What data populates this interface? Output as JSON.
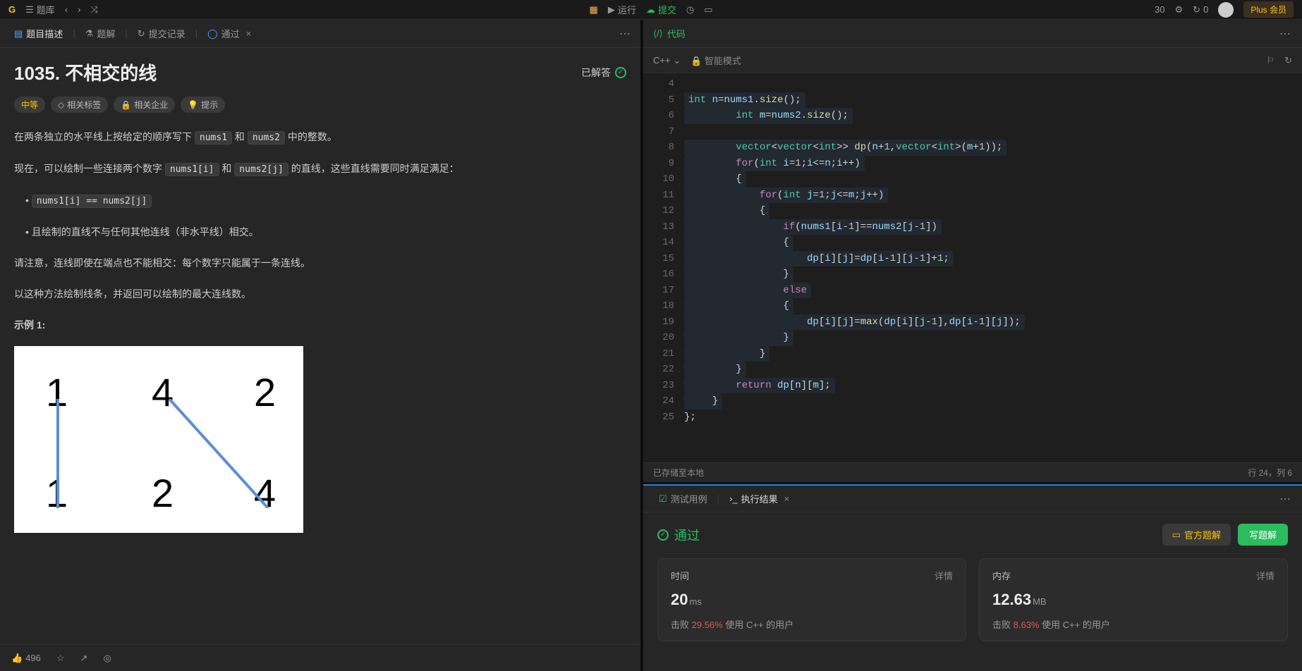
{
  "topbar": {
    "problems": "题库",
    "run": "运行",
    "submit": "提交",
    "timer": "0",
    "plus": "Plus 会员",
    "streak": "30"
  },
  "leftTabs": {
    "desc": "题目描述",
    "solution": "题解",
    "submissions": "提交记录",
    "accepted": "通过"
  },
  "problem": {
    "title": "1035. 不相交的线",
    "solvedLabel": "已解答",
    "difficulty": "中等",
    "tags": "相关标签",
    "companies": "相关企业",
    "hint": "提示",
    "p1a": "在两条独立的水平线上按给定的顺序写下 ",
    "code_nums1": "nums1",
    "p1b": " 和 ",
    "code_nums2": "nums2",
    "p1c": " 中的整数。",
    "p2a": "现在，可以绘制一些连接两个数字 ",
    "code_n1i": "nums1[i]",
    "p2b": " 和 ",
    "code_n2j": "nums2[j]",
    "p2c": " 的直线，这些直线需要同时满足满足：",
    "bullet1": "nums1[i] == nums2[j]",
    "bullet2": "且绘制的直线不与任何其他连线（非水平线）相交。",
    "p3": "请注意，连线即使在端点也不能相交：每个数字只能属于一条连线。",
    "p4": "以这种方法绘制线条，并返回可以绘制的最大连线数。",
    "ex1label": "示例 1:"
  },
  "footer": {
    "likes": "496"
  },
  "code": {
    "headerTitle": "代码",
    "lang": "C++",
    "smartMode": "智能模式",
    "savedLocal": "已存储至本地",
    "cursorPos": "行 24，列 6",
    "lineStart": 4,
    "lines": [
      "",
      "<span class='ty'>int</span> <span class='id'>n</span><span class='op'>=</span><span class='id'>nums1</span><span class='op'>.</span><span class='fn'>size</span><span class='op'>();</span>",
      "        <span class='ty'>int</span> <span class='id'>m</span><span class='op'>=</span><span class='id'>nums2</span><span class='op'>.</span><span class='fn'>size</span><span class='op'>();</span>",
      "",
      "        <span class='ty'>vector</span><span class='op'>&lt;</span><span class='ty'>vector</span><span class='op'>&lt;</span><span class='ty'>int</span><span class='op'>&gt;&gt;</span> <span class='fn'>dp</span><span class='op'>(</span><span class='id'>n</span><span class='op'>+</span><span class='nm'>1</span><span class='op'>,</span><span class='ty'>vector</span><span class='op'>&lt;</span><span class='ty'>int</span><span class='op'>&gt;(</span><span class='id'>m</span><span class='op'>+</span><span class='nm'>1</span><span class='op'>));</span>",
      "        <span class='kw'>for</span><span class='op'>(</span><span class='ty'>int</span> <span class='id'>i</span><span class='op'>=</span><span class='nm'>1</span><span class='op'>;</span><span class='id'>i</span><span class='op'>&lt;=</span><span class='id'>n</span><span class='op'>;</span><span class='id'>i</span><span class='op'>++)</span>",
      "        <span class='op'>{</span>",
      "            <span class='kw'>for</span><span class='op'>(</span><span class='ty'>int</span> <span class='id'>j</span><span class='op'>=</span><span class='nm'>1</span><span class='op'>;</span><span class='id'>j</span><span class='op'>&lt;=</span><span class='id'>m</span><span class='op'>;</span><span class='id'>j</span><span class='op'>++)</span>",
      "            <span class='op'>{</span>",
      "                <span class='kw'>if</span><span class='op'>(</span><span class='id'>nums1</span><span class='op'>[</span><span class='id'>i</span><span class='op'>-</span><span class='nm'>1</span><span class='op'>]==</span><span class='id'>nums2</span><span class='op'>[</span><span class='id'>j</span><span class='op'>-</span><span class='nm'>1</span><span class='op'>])</span>",
      "                <span class='op'>{</span>",
      "                    <span class='id'>dp</span><span class='op'>[</span><span class='id'>i</span><span class='op'>][</span><span class='id'>j</span><span class='op'>]=</span><span class='id'>dp</span><span class='op'>[</span><span class='id'>i</span><span class='op'>-</span><span class='nm'>1</span><span class='op'>][</span><span class='id'>j</span><span class='op'>-</span><span class='nm'>1</span><span class='op'>]+</span><span class='nm'>1</span><span class='op'>;</span>",
      "                <span class='op'>}</span>",
      "                <span class='kw'>else</span>",
      "                <span class='op'>{</span>",
      "                    <span class='id'>dp</span><span class='op'>[</span><span class='id'>i</span><span class='op'>][</span><span class='id'>j</span><span class='op'>]=</span><span class='fn'>max</span><span class='op'>(</span><span class='id'>dp</span><span class='op'>[</span><span class='id'>i</span><span class='op'>][</span><span class='id'>j</span><span class='op'>-</span><span class='nm'>1</span><span class='op'>],</span><span class='id'>dp</span><span class='op'>[</span><span class='id'>i</span><span class='op'>-</span><span class='nm'>1</span><span class='op'>][</span><span class='id'>j</span><span class='op'>]);</span>",
      "                <span class='op'>}</span>",
      "            <span class='op'>}</span>",
      "        <span class='op'>}</span>",
      "        <span class='kw'>return</span> <span class='id'>dp</span><span class='op'>[</span><span class='id'>n</span><span class='op'>][</span><span class='id'>m</span><span class='op'>];</span>",
      "    <span class='op'>}</span>",
      "<span class='op'>};</span>"
    ]
  },
  "resultTabs": {
    "testcase": "测试用例",
    "result": "执行结果"
  },
  "result": {
    "passLabel": "通过",
    "officialBtn": "官方题解",
    "writeBtn": "写题解",
    "time": {
      "label": "时间",
      "detail": "详情",
      "value": "20",
      "unit": "ms",
      "beatPrefix": "击败 ",
      "beatPct": "29.56%",
      "beatSuffix": " 使用 C++ 的用户"
    },
    "memory": {
      "label": "内存",
      "detail": "详情",
      "value": "12.63",
      "unit": "MB",
      "beatPrefix": "击败 ",
      "beatPct": "8.63%",
      "beatSuffix": " 使用 C++ 的用户"
    }
  }
}
